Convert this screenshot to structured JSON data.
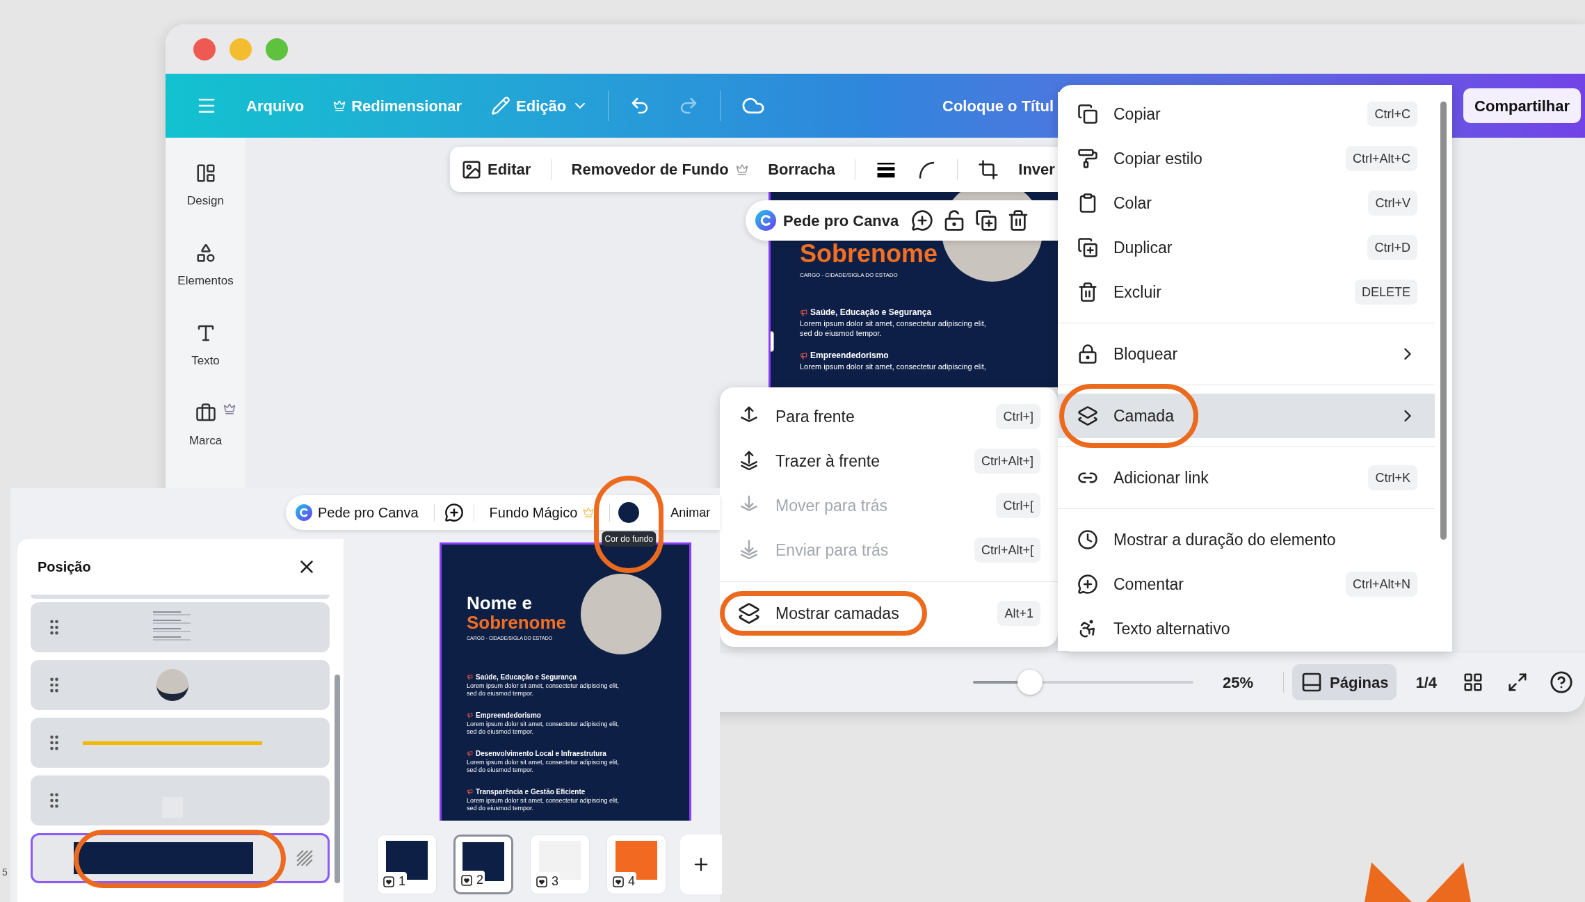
{
  "window": {
    "title": "Coloque o Títul"
  },
  "header": {
    "menu": [
      {
        "label": "Arquivo",
        "premium": false
      },
      {
        "label": "Redimensionar",
        "premium": true
      },
      {
        "label": "Edição",
        "premium": false
      }
    ],
    "share": "Compartilhar"
  },
  "sidebar": {
    "items": [
      {
        "label": "Design",
        "premium": false
      },
      {
        "label": "Elementos",
        "premium": false
      },
      {
        "label": "Texto",
        "premium": false
      },
      {
        "label": "Marca",
        "premium": true
      }
    ]
  },
  "image_toolbar": {
    "edit": "Editar",
    "remove_background": "Removedor de Fundo",
    "eraser": "Borracha",
    "cut_item": "Inver"
  },
  "element_toolbar": {
    "assistant": "Pede pro Canva"
  },
  "design_preview": {
    "surname": "Sobrenome",
    "role": "CARGO - CIDADE/SIGLA DO ESTADO",
    "sections": [
      {
        "title": "Saúde, Educação e Segurança",
        "lines": [
          "Lorem ipsum dolor sit amet, consectetur adipiscing elit,",
          "sed do eiusmod tempor."
        ]
      },
      {
        "title": "Empreendedorismo",
        "lines": [
          "Lorem ipsum dolor sit amet, consectetur adipiscing elit,"
        ]
      }
    ]
  },
  "context_menu": {
    "groups": [
      [
        {
          "label": "Copiar",
          "shortcut": "Ctrl+C",
          "submenu": false,
          "selected": false,
          "circled": false
        },
        {
          "label": "Copiar estilo",
          "shortcut": "Ctrl+Alt+C",
          "submenu": false,
          "selected": false,
          "circled": false
        },
        {
          "label": "Colar",
          "shortcut": "Ctrl+V",
          "submenu": false,
          "selected": false,
          "circled": false
        },
        {
          "label": "Duplicar",
          "shortcut": "Ctrl+D",
          "submenu": false,
          "selected": false,
          "circled": false
        },
        {
          "label": "Excluir",
          "shortcut": "DELETE",
          "submenu": false,
          "selected": false,
          "circled": false
        }
      ],
      [
        {
          "label": "Bloquear",
          "submenu": true,
          "selected": false,
          "circled": false
        }
      ],
      [
        {
          "label": "Camada",
          "submenu": true,
          "selected": true,
          "circled": true
        }
      ],
      [
        {
          "label": "Adicionar link",
          "shortcut": "Ctrl+K",
          "submenu": false,
          "selected": false,
          "circled": false
        }
      ],
      [
        {
          "label": "Mostrar a duração do elemento",
          "submenu": false,
          "selected": false,
          "circled": false
        },
        {
          "label": "Comentar",
          "shortcut": "Ctrl+Alt+N",
          "submenu": false,
          "selected": false,
          "circled": false
        },
        {
          "label": "Texto alternativo",
          "submenu": false,
          "selected": false,
          "circled": false
        }
      ]
    ]
  },
  "layer_menu": {
    "groups": [
      [
        {
          "label": "Para frente",
          "shortcut": "Ctrl+]",
          "disabled": false,
          "circled": false
        },
        {
          "label": "Trazer à frente",
          "shortcut": "Ctrl+Alt+]",
          "disabled": false,
          "circled": false
        },
        {
          "label": "Mover para trás",
          "shortcut": "Ctrl+[",
          "disabled": true,
          "circled": false
        },
        {
          "label": "Enviar para trás",
          "shortcut": "Ctrl+Alt+[",
          "disabled": true,
          "circled": false
        }
      ],
      [
        {
          "label": "Mostrar camadas",
          "shortcut": "Alt+1",
          "disabled": false,
          "circled": true
        }
      ]
    ]
  },
  "bottom_bar": {
    "zoom": {
      "level": 0.26
    },
    "zoom_text": "25%",
    "pages_button": "Páginas",
    "page_counter": "1/4"
  },
  "layers_view": {
    "toolbar": {
      "assistant": "Pede pro Canva",
      "magic_background": "Fundo Mágico",
      "premium": true,
      "background_color": {
        "color": "#0d1f45",
        "circled": true
      },
      "animate": "Animar",
      "tooltip": "Cor do fundo"
    },
    "position_panel": {
      "title": "Posição",
      "layers": [
        {
          "kind": "text",
          "selected": false,
          "circled": false
        },
        {
          "kind": "photo",
          "selected": false,
          "circled": false
        },
        {
          "kind": "line",
          "selected": false,
          "circled": false
        },
        {
          "kind": "texture",
          "selected": false,
          "circled": false
        },
        {
          "kind": "background",
          "selected": true,
          "circled": true
        }
      ]
    },
    "page": {
      "name": "Nome e",
      "surname": "Sobrenome",
      "role": "CARGO - CIDADE/SIGLA DO ESTADO",
      "sections": [
        {
          "title": "Saúde, Educação e Segurança",
          "lines": [
            "Lorem ipsum dolor sit amet, consectetur adipiscing elit,",
            "sed do eiusmod tempor."
          ]
        },
        {
          "title": "Empreendedorismo",
          "lines": [
            "Lorem ipsum dolor sit amet, consectetur adipiscing elit,",
            "sed do eiusmod tempor."
          ]
        },
        {
          "title": "Desenvolvimento Local e Infraestrutura",
          "lines": [
            "Lorem ipsum dolor sit amet, consectetur adipiscing elit,",
            "sed do eiusmod tempor."
          ]
        },
        {
          "title": "Transparência e Gestão Eficiente",
          "lines": [
            "Lorem ipsum dolor sit amet, consectetur adipiscing elit,",
            "sed do eiusmod tempor."
          ]
        }
      ]
    },
    "pages": [
      {
        "number": "1",
        "color": "#0d1f45",
        "selected": false
      },
      {
        "number": "2",
        "color": "#0d1f45",
        "selected": true
      },
      {
        "number": "3",
        "color": "#f2f2f2",
        "selected": false
      },
      {
        "number": "4",
        "color": "#f26a21",
        "selected": false
      }
    ]
  },
  "edge_text": "5"
}
